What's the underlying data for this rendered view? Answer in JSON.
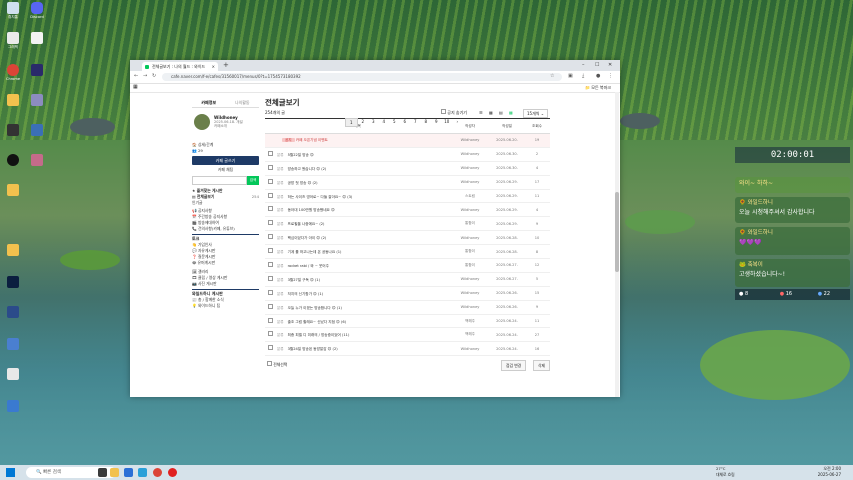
{
  "browser": {
    "tab_title": "전체글보기 : 나의 월드 : 와이드",
    "url": "cafe.naver.com/f-e/cafes/31560017/menus/0?t=1754573180392",
    "bookmark_folder": "모든 북마크"
  },
  "sidebar": {
    "tab_cafe_info": "카페정보",
    "tab_my_activity": "나의활동",
    "profile_name": "Wildhoney",
    "profile_sub": "2025.06.18. 개설",
    "profile_sub2": "카페소개",
    "stats": "상세/간계",
    "member_count": "29",
    "join_button": "카페 글쓰기",
    "chat_label": "카페 채팅",
    "search_button": "검색",
    "fav_heading": "즐겨찾는 게시판",
    "all_posts": "전체글보기",
    "all_posts_count": "254",
    "popular": "인기글",
    "menu": [
      "공지사항",
      "주간방송 공지사항",
      "방송에대하여",
      "건의사항(카페, 유튜브)"
    ],
    "section_talk": "토크",
    "menu2": [
      "가입인사",
      "자유게시판",
      "질문게시판",
      "유머게시판"
    ],
    "menu3": [
      "갤러리",
      "클립 / 영상 게시판",
      "사진 게시판"
    ],
    "section_guide": "와일드하니 게시판",
    "menu4": [
      "총 / 함께한 소식",
      "와이드하니 팁"
    ]
  },
  "main": {
    "title": "전체글보기",
    "count": "254개의 글",
    "notice_toggle": "공지 숨기기",
    "per_page": "15개씩",
    "col_title": "제목",
    "col_author": "작성자",
    "col_date": "작성일",
    "col_views": "조회수",
    "rows": [
      {
        "title": "카페 오픈기념 이벤트",
        "author": "Wildhoney",
        "date": "2025.06.20.",
        "views": "19",
        "notice": true
      },
      {
        "title": "5월22일 방송 😊",
        "author": "Wildhoney",
        "date": "2025.06.30.",
        "views": "2"
      },
      {
        "title": "방송하고 왔습니다 😊 (2)",
        "author": "Wildhoney",
        "date": "2025.06.30.",
        "views": "4"
      },
      {
        "title": "공방 첫 방송 😊 (2)",
        "author": "Wildhoney",
        "date": "2025.06.29.",
        "views": "17"
      },
      {
        "title": "하는 사이즈 영어로~ 다들 잘아요~ 😊 (3)",
        "author": "스트림",
        "date": "2025.06.29.",
        "views": "11"
      },
      {
        "title": "동아대 100만원 방송했네요 😊",
        "author": "Wildhoney",
        "date": "2025.06.29.",
        "views": "4"
      },
      {
        "title": "프로필을 나중에요~ (2)",
        "author": "통합이",
        "date": "2025.06.29.",
        "views": "9"
      },
      {
        "title": "핵심이었다가 아이 😊 (2)",
        "author": "Wildhoney",
        "date": "2025.06.28.",
        "views": "10"
      },
      {
        "title": "기계 를 하고나는데 온 공동나요 (1)",
        "author": "통합이",
        "date": "2025.06.28.",
        "views": "8"
      },
      {
        "title": "rocket rabi / 와 ~ 웃어주",
        "author": "통합이",
        "date": "2025.06.27.",
        "views": "12"
      },
      {
        "title": "3월27일 구독 😊 (1)",
        "author": "Wildhoney",
        "date": "2025.06.27.",
        "views": "5"
      },
      {
        "title": "저지의 신기함가 😊 (1)",
        "author": "Wildhoney",
        "date": "2025.06.26.",
        "views": "15"
      },
      {
        "title": "오늘 누가 이겠는 방송합니다 😊 (1)",
        "author": "Wildhoney",
        "date": "2025.06.26.",
        "views": "9"
      },
      {
        "title": "출조 그럼 할래요~ 신났다 지점 😊 (6)",
        "author": "백해주",
        "date": "2025.06.24.",
        "views": "11"
      },
      {
        "title": "최종 피델 디 미래의 / 방송중이었어 (11)",
        "author": "백해주",
        "date": "2025.06.24.",
        "views": "27"
      },
      {
        "title": "3월24일 방송된 동방말감 😊 (2)",
        "author": "Wildhoney",
        "date": "2025.06.24.",
        "views": "16"
      }
    ],
    "select_all": "전체선택",
    "move_button": "점검 변경",
    "delete_button": "삭제",
    "pages": [
      "1",
      "2",
      "3",
      "4",
      "5",
      "6",
      "7",
      "8",
      "9",
      "10",
      "›"
    ]
  },
  "widget": {
    "timer": "02:00:01",
    "chats": [
      {
        "name": "",
        "text": "와이~ 하하~"
      },
      {
        "name": "와일드하니",
        "text": "오늘 시청해주셔서 감사합니다"
      },
      {
        "name": "와일드하니",
        "text": "💜💜💜"
      },
      {
        "name": "축복이",
        "text": "고생하셨습니다~!"
      }
    ],
    "stat1": "8",
    "stat2": "16",
    "stat3": "22"
  },
  "desktop_icons": [
    "휴지통",
    "Discord",
    "그래픽",
    "",
    "Chrome",
    "OBS",
    "",
    "",
    "",
    "",
    "",
    "",
    "",
    "",
    "",
    "",
    "Steam",
    "",
    "OBS",
    "",
    "",
    "",
    "",
    "",
    ""
  ],
  "taskbar": {
    "search_placeholder": "빠른 검색",
    "weather_temp": "27°C",
    "weather_desc": "대체로 흐림",
    "time": "오전 2:00",
    "date": "2025-06-27"
  }
}
